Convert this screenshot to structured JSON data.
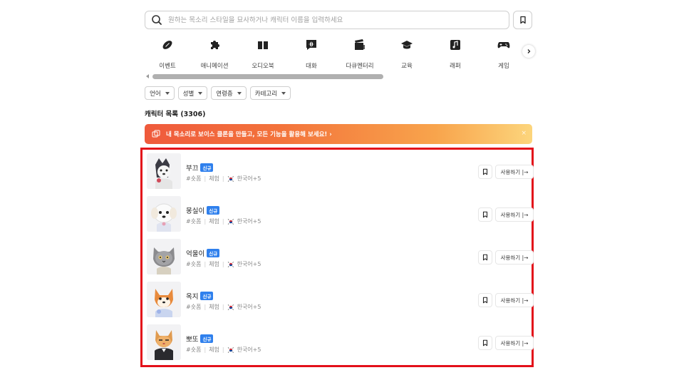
{
  "search": {
    "placeholder": "원하는 목소리 스타일을 묘사하거나 캐릭터 이름을 입력하세요",
    "value": ""
  },
  "categories": [
    {
      "label": "이벤트",
      "icon": "football-icon"
    },
    {
      "label": "애니메이션",
      "icon": "puzzle-icon"
    },
    {
      "label": "오디오북",
      "icon": "book-icon"
    },
    {
      "label": "대화",
      "icon": "chat-waveform-icon"
    },
    {
      "label": "다큐멘터리",
      "icon": "clapperboard-icon"
    },
    {
      "label": "교육",
      "icon": "graduation-cap-icon"
    },
    {
      "label": "래퍼",
      "icon": "music-note-icon"
    },
    {
      "label": "게임",
      "icon": "gamepad-icon"
    }
  ],
  "filters": [
    {
      "label": "언어"
    },
    {
      "label": "성별"
    },
    {
      "label": "연령층"
    },
    {
      "label": "카테고리"
    }
  ],
  "list_title": "캐릭터 목록 (3306)",
  "banner": {
    "text": "내 목소리로 보이스 클론을 만들고, 모든 기능을 활용해 보세요! ›",
    "close": "×"
  },
  "characters": [
    {
      "name": "부끄",
      "badge": "신규",
      "tag": "#숏폼",
      "type": "체험",
      "languages": "한국어+5",
      "use_label": "사용하기 |→",
      "avatar": "husky-dog"
    },
    {
      "name": "몽실이",
      "badge": "신규",
      "tag": "#숏폼",
      "type": "체험",
      "languages": "한국어+5",
      "use_label": "사용하기 |→",
      "avatar": "white-puppy"
    },
    {
      "name": "억울이",
      "badge": "신규",
      "tag": "#숏폼",
      "type": "체험",
      "languages": "한국어+5",
      "use_label": "사용하기 |→",
      "avatar": "grey-cat"
    },
    {
      "name": "옥지",
      "badge": "신규",
      "tag": "#숏폼",
      "type": "체험",
      "languages": "한국어+5",
      "use_label": "사용하기 |→",
      "avatar": "shiba-dog"
    },
    {
      "name": "뽀또",
      "badge": "신규",
      "tag": "#숏폼",
      "type": "체험",
      "languages": "한국어+5",
      "use_label": "사용하기 |→",
      "avatar": "orange-cat"
    }
  ],
  "colors": {
    "accent": "#2f80ed",
    "highlight_frame": "#e3101a",
    "banner_start": "#ef5a3c",
    "banner_end": "#fcd57c"
  }
}
